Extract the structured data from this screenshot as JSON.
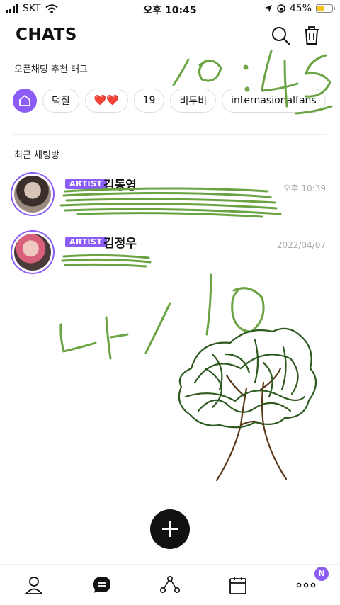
{
  "status_bar": {
    "carrier": "SKT",
    "time": "오후 10:45",
    "battery_percent_label": "45%",
    "battery_level": 0.45
  },
  "header": {
    "title": "CHATS",
    "search_icon": "search-icon",
    "trash_icon": "trash-icon"
  },
  "open_chat_tags": {
    "label": "오픈채팅 추천 태그",
    "items": [
      {
        "label": "덕질"
      },
      {
        "label": "❤️❤️"
      },
      {
        "label": "19"
      },
      {
        "label": "비투비"
      },
      {
        "label": "internasionalfans"
      }
    ]
  },
  "recent": {
    "label": "최근 채팅방",
    "chats": [
      {
        "badge": "ARTIST",
        "name": "김동영",
        "time": "오후 10:39",
        "preview": ""
      },
      {
        "badge": "ARTIST",
        "name": "김정우",
        "time": "2022/04/07",
        "preview": ""
      }
    ]
  },
  "bottom_nav": {
    "items": [
      "profile-icon",
      "chat-icon",
      "share-icon",
      "calendar-icon",
      "more-icon"
    ],
    "notification_badge": "N"
  },
  "colors": {
    "accent": "#8b5cf6",
    "scribble_green": "#6aa342",
    "tree_dark_green": "#2f5a1f",
    "tree_brown": "#5a3a1a"
  }
}
